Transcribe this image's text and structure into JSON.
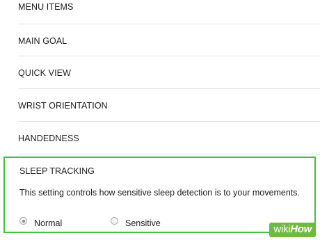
{
  "menu": {
    "items": [
      {
        "label": "MENU ITEMS"
      },
      {
        "label": "MAIN GOAL"
      },
      {
        "label": "QUICK VIEW"
      },
      {
        "label": "WRIST ORIENTATION"
      },
      {
        "label": "HANDEDNESS"
      }
    ]
  },
  "sleep_tracking": {
    "title": "SLEEP TRACKING",
    "description": "This setting controls how sensitive sleep detection is to your movements.",
    "options": [
      {
        "label": "Normal",
        "selected": true
      },
      {
        "label": "Sensitive",
        "selected": false
      }
    ],
    "highlight_color": "#3ec43a"
  },
  "watermark": {
    "part1": "wiki",
    "part2": "How",
    "color": "#6dbb3f"
  }
}
